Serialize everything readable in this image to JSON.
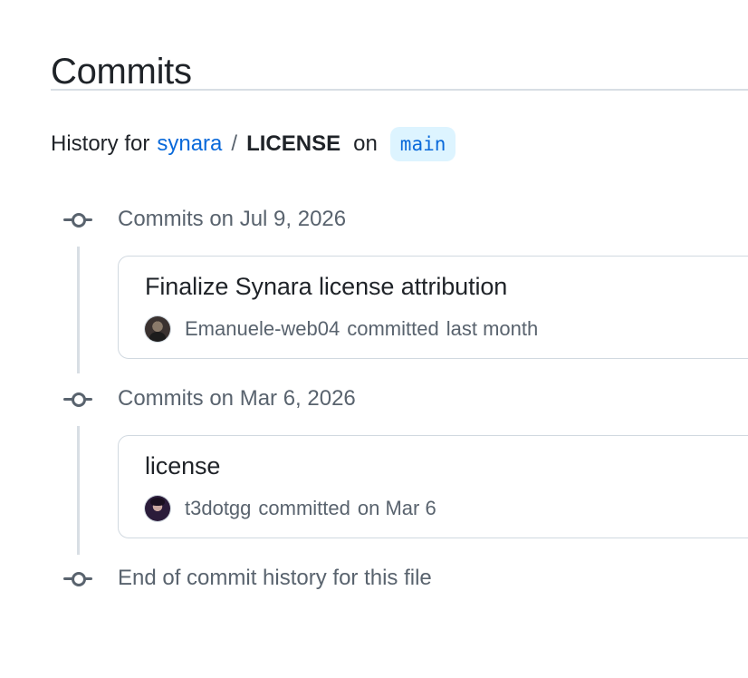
{
  "page": {
    "title": "Commits"
  },
  "history": {
    "prefix": "History for",
    "repo": "synara",
    "separator": "/",
    "file": "LICENSE",
    "on_label": "on",
    "branch": "main"
  },
  "groups": [
    {
      "title": "Commits on Jul 9, 2026",
      "commits": [
        {
          "message": "Finalize Synara license attribution",
          "author": "Emanuele-web04",
          "action": "committed",
          "time": "last month"
        }
      ]
    },
    {
      "title": "Commits on Mar 6, 2026",
      "commits": [
        {
          "message": "license",
          "author": "t3dotgg",
          "action": "committed",
          "time": "on Mar 6"
        }
      ]
    }
  ],
  "end_label": "End of commit history for this file",
  "colors": {
    "link": "#0969da",
    "muted": "#59636e",
    "border": "#d1d9e0",
    "branch_badge_bg": "#ddf4ff"
  },
  "icons": {
    "commit_node": "git-commit-icon"
  }
}
